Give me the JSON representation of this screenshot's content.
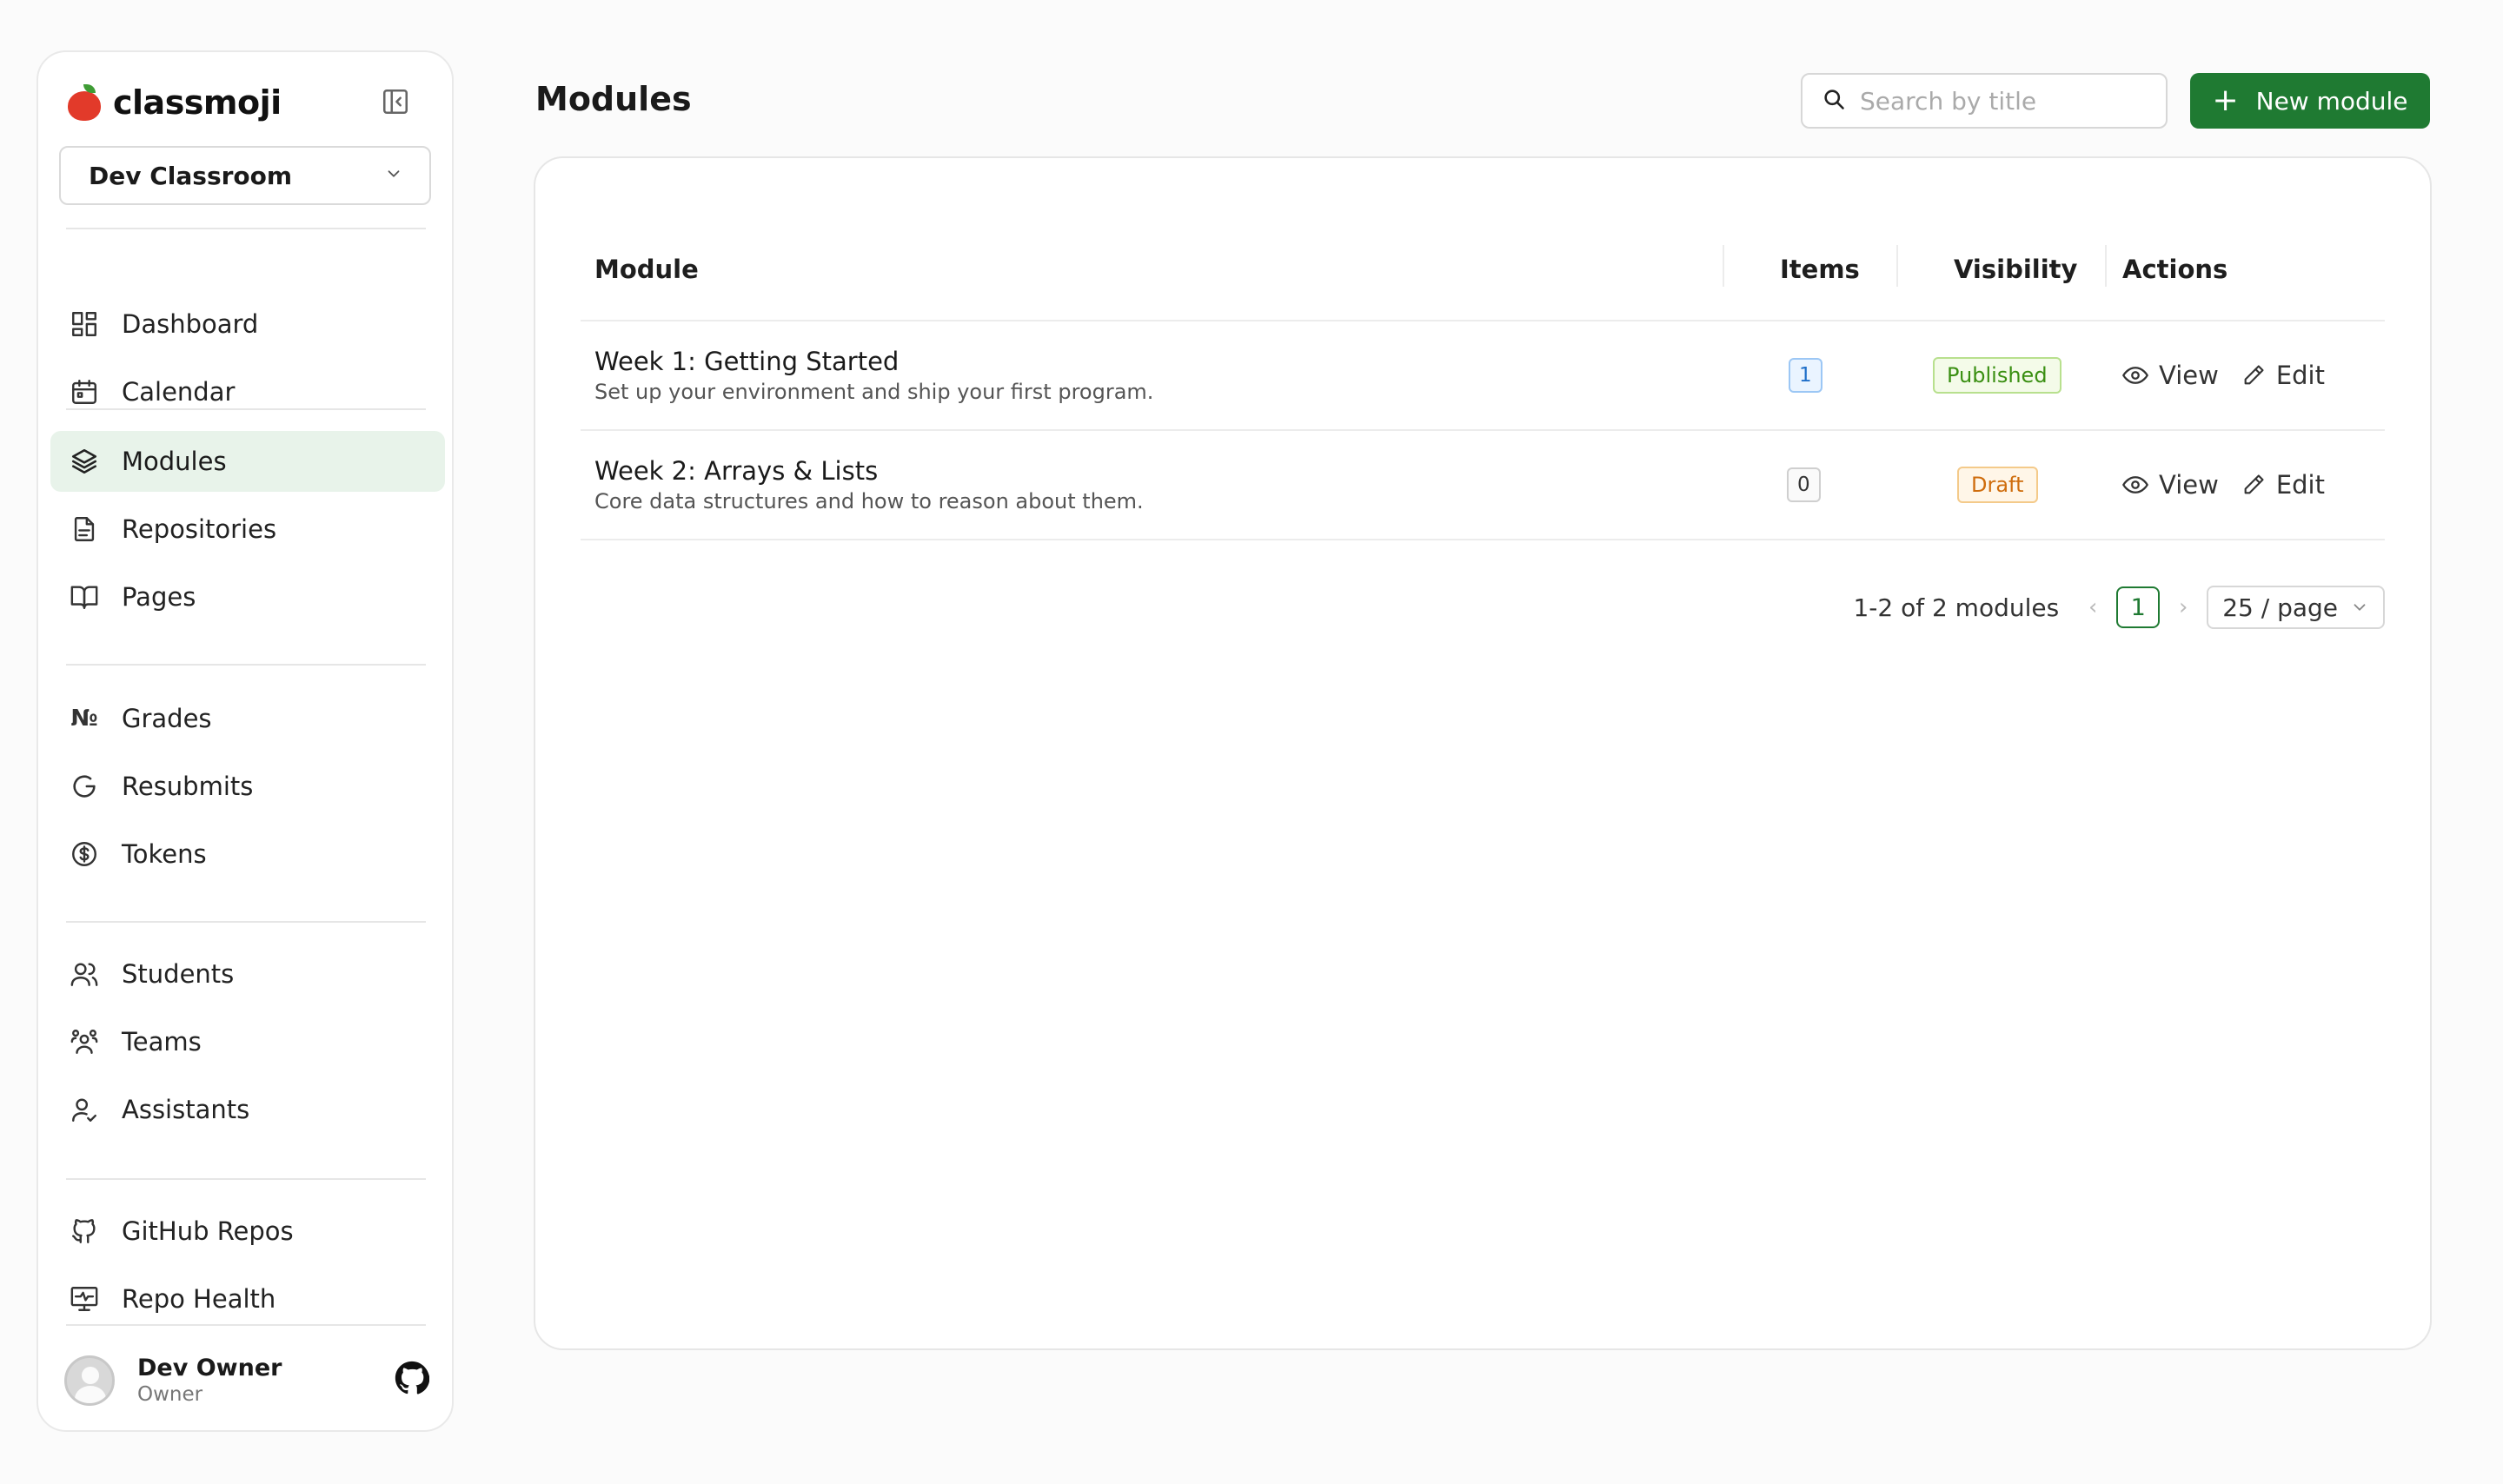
{
  "brand": {
    "name": "classmoji"
  },
  "classroom_select": {
    "value": "Dev Classroom"
  },
  "nav": {
    "dashboard": "Dashboard",
    "calendar": "Calendar",
    "modules": "Modules",
    "repositories": "Repositories",
    "pages": "Pages",
    "grades": "Grades",
    "resubmits": "Resubmits",
    "tokens": "Tokens",
    "students": "Students",
    "teams": "Teams",
    "assistants": "Assistants",
    "github_repos": "GitHub Repos",
    "repo_health": "Repo Health"
  },
  "user": {
    "name": "Dev Owner",
    "role": "Owner"
  },
  "header": {
    "title": "Modules",
    "search_placeholder": "Search by title",
    "new_button": "New module"
  },
  "table": {
    "columns": {
      "module": "Module",
      "items": "Items",
      "visibility": "Visibility",
      "actions": "Actions"
    },
    "rows": [
      {
        "title": "Week 1: Getting Started",
        "description": "Set up your environment and ship your first program.",
        "items": "1",
        "visibility": "Published",
        "view": "View",
        "edit": "Edit"
      },
      {
        "title": "Week 2: Arrays & Lists",
        "description": "Core data structures and how to reason about them.",
        "items": "0",
        "visibility": "Draft",
        "view": "View",
        "edit": "Edit"
      }
    ]
  },
  "pagination": {
    "summary": "1-2 of 2 modules",
    "current_page": "1",
    "page_size": "25 / page"
  },
  "colors": {
    "primary": "#1f7a32",
    "active_nav_bg": "#e8f3ea",
    "published": "#3a8f12",
    "draft": "#cf6d0d",
    "items_badge": "#1f6fc9"
  }
}
